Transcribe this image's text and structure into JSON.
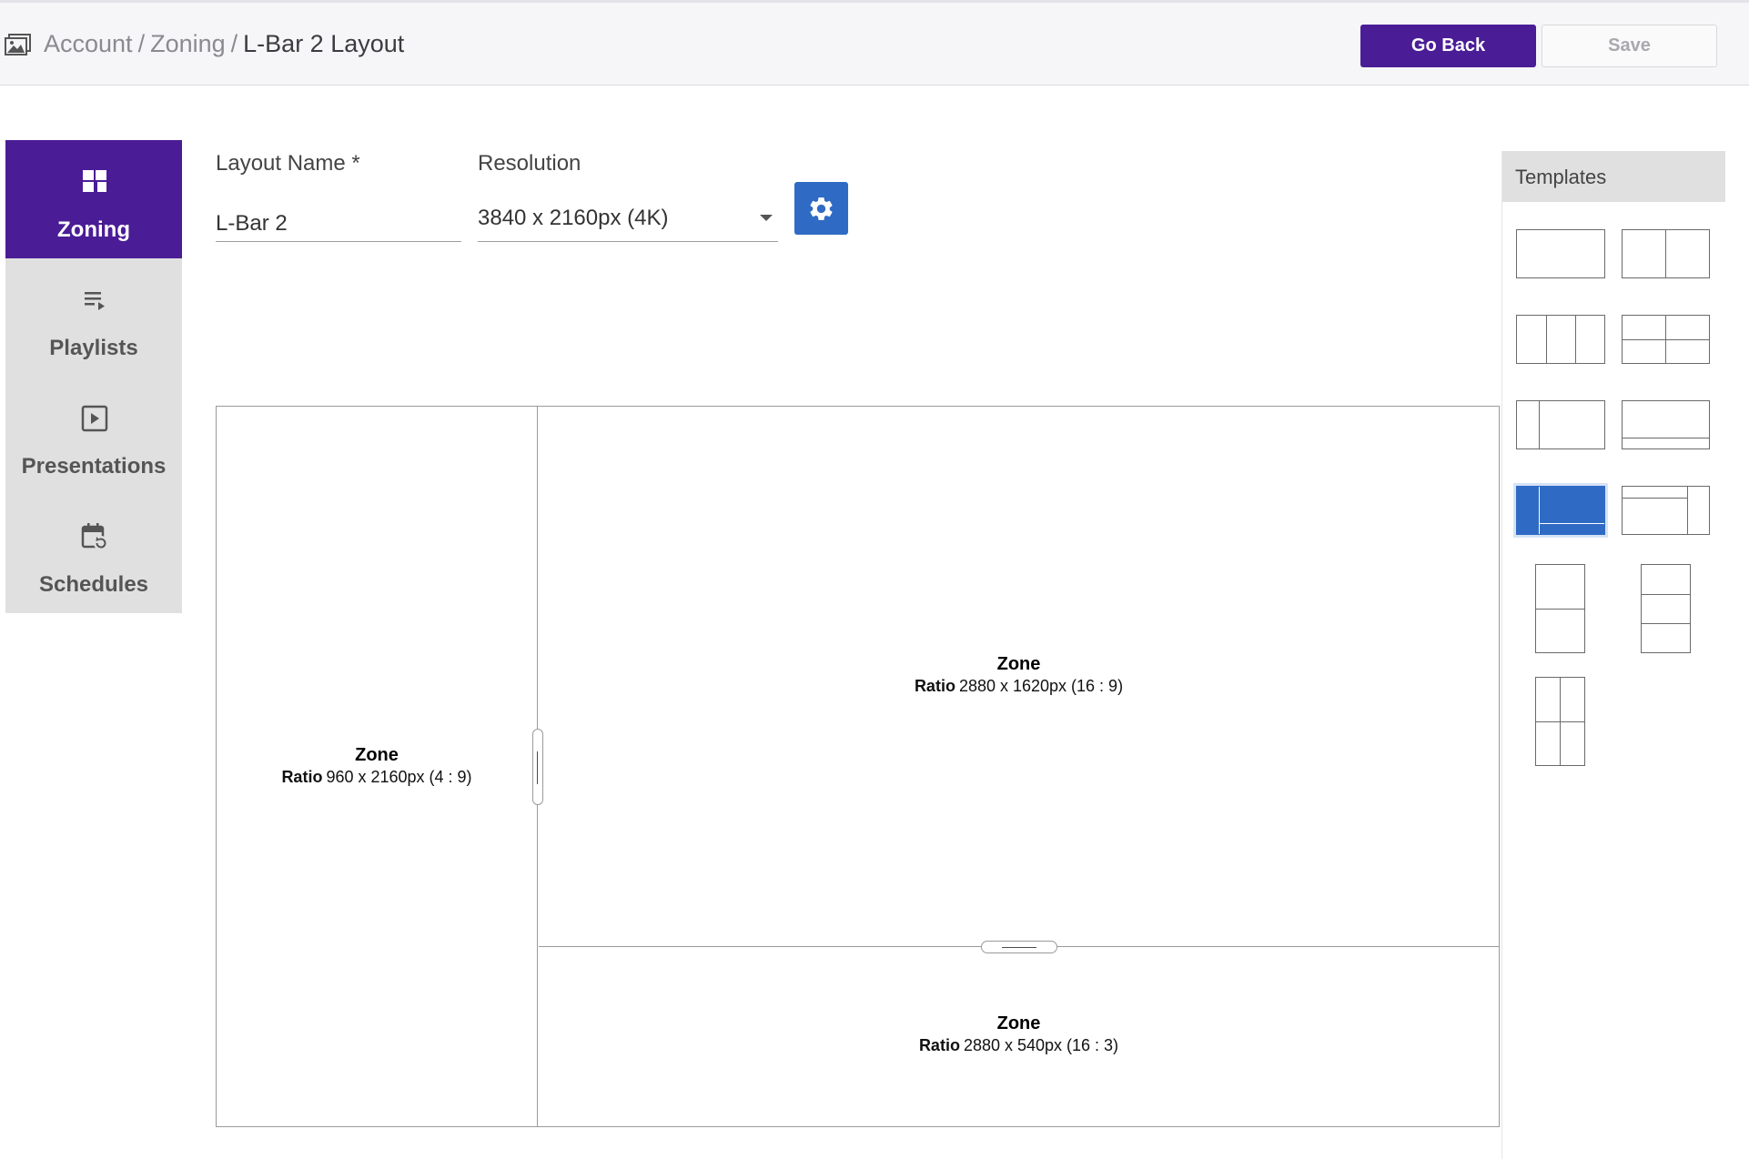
{
  "header": {
    "breadcrumb": [
      "Account",
      "Zoning",
      "L-Bar 2 Layout"
    ],
    "separator": "/",
    "go_back_label": "Go Back",
    "save_label": "Save"
  },
  "sidenav": {
    "items": [
      {
        "label": "Zoning",
        "icon": "dashboard-icon",
        "active": true
      },
      {
        "label": "Playlists",
        "icon": "playlist-play-icon",
        "active": false
      },
      {
        "label": "Presentations",
        "icon": "slideshow-icon",
        "active": false
      },
      {
        "label": "Schedules",
        "icon": "calendar-refresh-icon",
        "active": false
      }
    ]
  },
  "form": {
    "layout_name_label": "Layout Name *",
    "layout_name_value": "L-Bar 2",
    "resolution_label": "Resolution",
    "resolution_value": "3840 x 2160px (4K)"
  },
  "zones": [
    {
      "title": "Zone",
      "ratio_key": "Ratio",
      "ratio": "960 x 2160px (4 : 9)"
    },
    {
      "title": "Zone",
      "ratio_key": "Ratio",
      "ratio": "2880 x 1620px (16 : 9)"
    },
    {
      "title": "Zone",
      "ratio_key": "Ratio",
      "ratio": "2880 x 540px (16 : 3)"
    }
  ],
  "templates": {
    "title": "Templates",
    "selected_index": 6
  },
  "colors": {
    "brand_purple": "#4a1d96",
    "accent_blue": "#2f6bc4",
    "nav_bg": "#e0e0e0"
  }
}
